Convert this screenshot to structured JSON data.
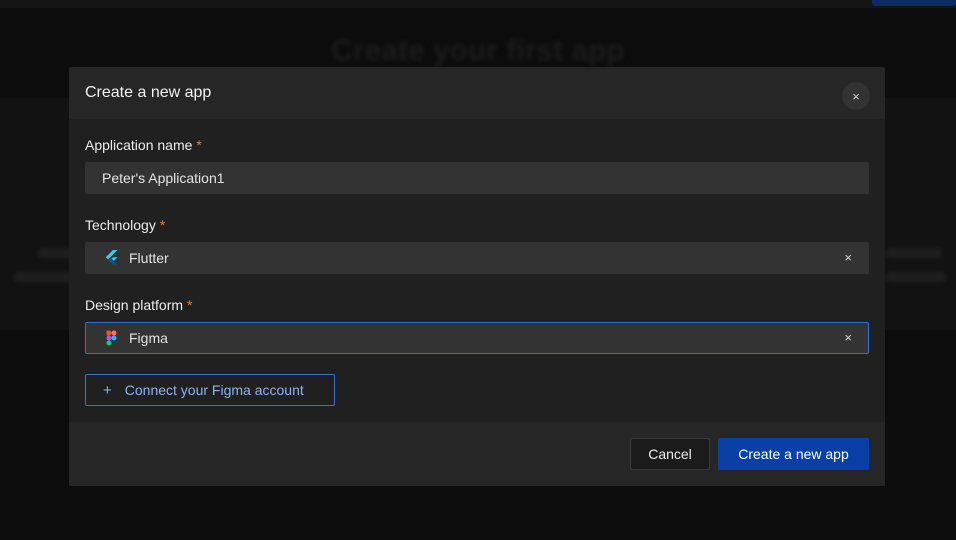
{
  "background": {
    "heading": "Create your first app"
  },
  "modal": {
    "title": "Create a new app",
    "close_label": "×",
    "fields": {
      "app_name": {
        "label": "Application name",
        "required_mark": "*",
        "value": "Peter's Application1"
      },
      "technology": {
        "label": "Technology",
        "required_mark": "*",
        "value": "Flutter",
        "icon": "flutter-icon",
        "clear_label": "×"
      },
      "design_platform": {
        "label": "Design platform",
        "required_mark": "*",
        "value": "Figma",
        "icon": "figma-icon",
        "clear_label": "×"
      }
    },
    "connect_button": {
      "icon_glyph": "+",
      "label": "Connect your Figma account"
    },
    "footer": {
      "cancel_label": "Cancel",
      "create_label": "Create a new app"
    }
  },
  "colors": {
    "required": "#e8813a",
    "accent": "#0a3fa8",
    "focus_border": "#2f6fe0"
  }
}
